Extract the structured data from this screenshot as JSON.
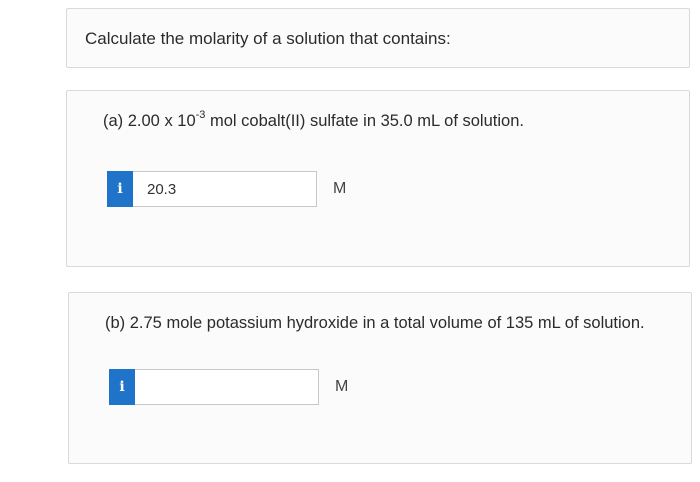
{
  "header": {
    "prompt": "Calculate the molarity of a solution that contains:"
  },
  "part_a": {
    "question_prefix": "(a) 2.00 x 10",
    "question_exponent": "-3",
    "question_suffix": " mol cobalt(II) sulfate in 35.0 mL of solution.",
    "info_icon": "i",
    "answer_value": "20.3",
    "unit": "M"
  },
  "part_b": {
    "question": "(b) 2.75 mole potassium hydroxide in a total volume of 135 mL of solution.",
    "info_icon": "i",
    "answer_value": "",
    "unit": "M"
  },
  "colors": {
    "info_button": "#1f73c8",
    "panel_background": "#fbfbfb",
    "panel_border": "#d9d9d9"
  }
}
